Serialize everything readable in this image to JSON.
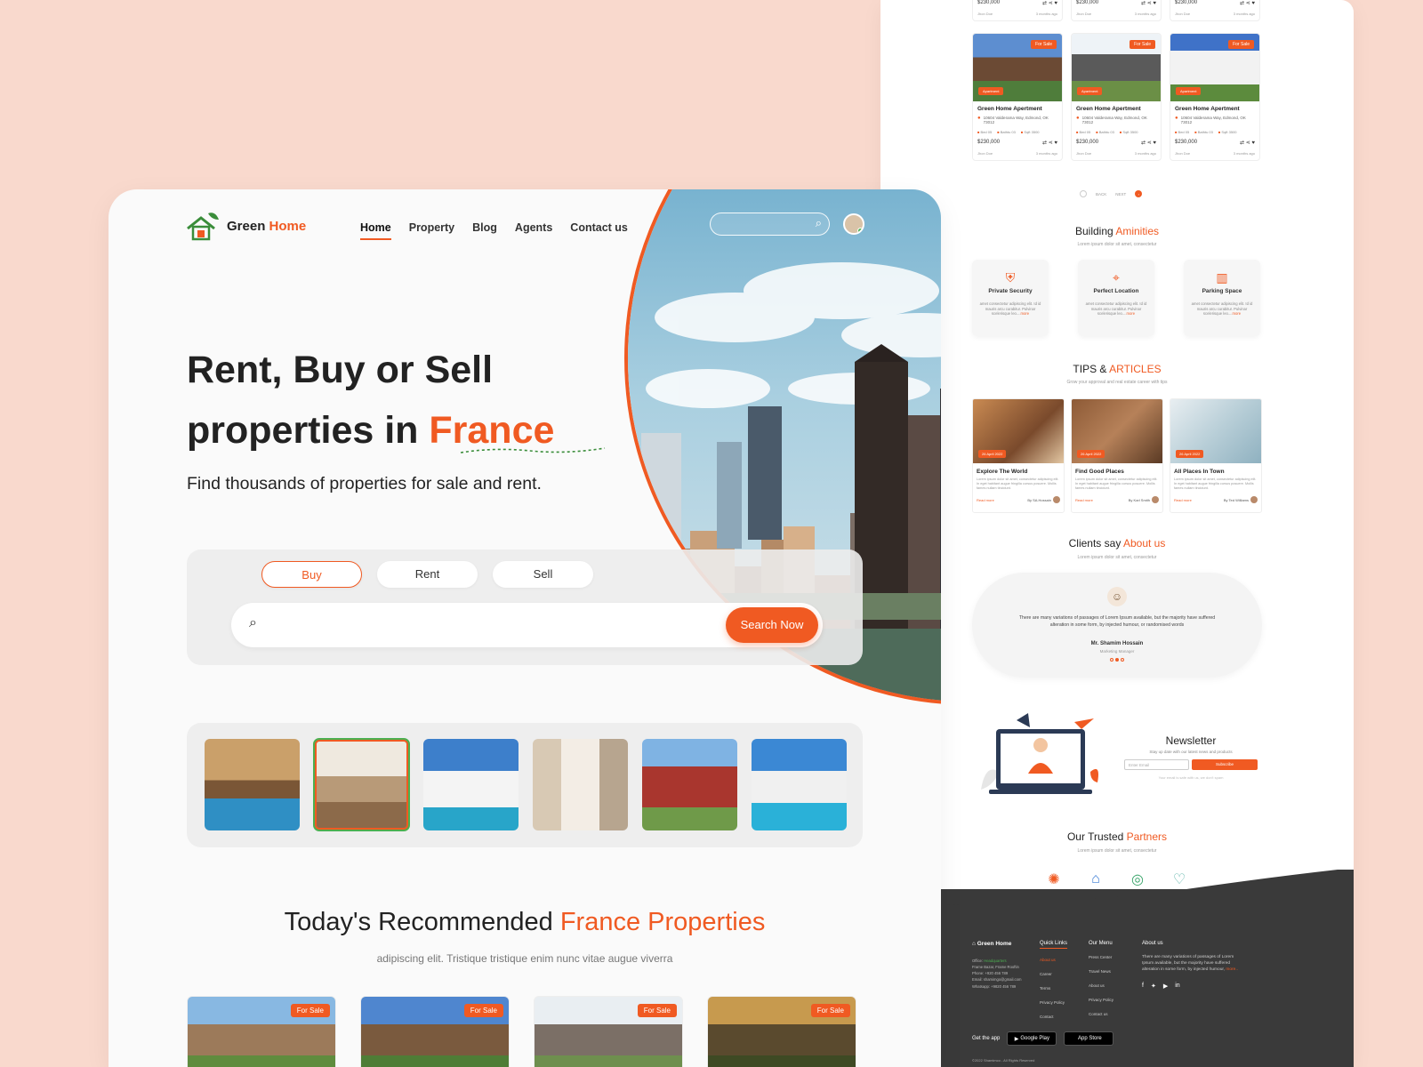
{
  "colors": {
    "accent": "#f05a22",
    "green": "#4caf50",
    "background": "#f9d9cd",
    "footer": "#3a3a3a"
  },
  "main": {
    "logo": {
      "brand_1": "Green",
      "brand_2": "Home",
      "icon": "house-logo-icon"
    },
    "nav": [
      "Home",
      "Property",
      "Blog",
      "Agents",
      "Contact us"
    ],
    "hero": {
      "line1": "Rent, Buy or Sell",
      "line2_prefix": "properties in ",
      "line2_highlight": "France",
      "subtitle": "Find thousands of properties for sale and rent."
    },
    "search": {
      "tabs": [
        "Buy",
        "Rent",
        "Sell"
      ],
      "active_tab": "Buy",
      "input_value": "",
      "button": "Search Now"
    },
    "recommended": {
      "title_prefix": "Today's Recommended ",
      "title_highlight": "France Properties",
      "subtitle": "adipiscing elit. Tristique tristique enim nunc vitae augue viverra",
      "tag": "For Sale"
    }
  },
  "right": {
    "listing": {
      "price": "$230,000",
      "title": "Green Home Apertment",
      "address": "10604 Valderama Way, Edmond, OK 73012",
      "features": [
        "Bed 05",
        "Bathtu 03",
        "Sqft 3500"
      ],
      "agent": "Jhon Doe",
      "time": "3 months ago",
      "tag_sale": "For Sale",
      "tag_type": "Apartment"
    },
    "pager": {
      "back": "BACK",
      "next": "NEXT"
    },
    "amenities": {
      "title_prefix": "Building ",
      "title_highlight": "Aminities",
      "subtitle": "Lorem ipsum dolor sit amet, consectetur",
      "items": [
        {
          "name": "Private Security",
          "icon": "shield-icon"
        },
        {
          "name": "Perfect Location",
          "icon": "location-pin-icon"
        },
        {
          "name": "Parking Space",
          "icon": "parking-icon"
        }
      ],
      "desc": "amet consectetur adipiscing elit. Id id mauris arcu curabitur. Pulvinar scelerisque leo....",
      "more": "more"
    },
    "tips": {
      "title_prefix": "TIPS & ",
      "title_highlight": "ARTICLES",
      "subtitle": "Grow your approval and real estate career with tips",
      "items": [
        {
          "title": "Explore The World",
          "date": "26 April 2022",
          "author": "By SA.Hossain"
        },
        {
          "title": "Find Good Places",
          "date": "26 April 2022",
          "author": "By Karl Smith"
        },
        {
          "title": "All Places In Town",
          "date": "26 April 2022",
          "author": "By Ted Williams"
        }
      ],
      "desc": "Lorem ipsum dolor sit amet, consectetur adipiscing elit. In eget habitant augue fringilla cursus posuere. Mollis fames nullam tincidunt.",
      "read_more": "Read more"
    },
    "testimonial": {
      "title_prefix": "Clients say ",
      "title_highlight": "About us",
      "subtitle": "Lorem ipsum dolor sit amet, consectetur",
      "text": "There are many variations of passages of Lorem Ipsum available, but the majority have suffered alteration in some form, by injected humour, or randomised words",
      "name": "Mr. Shamim Hossain",
      "role": "Marketing Manager"
    },
    "newsletter": {
      "title": "Newsletter",
      "subtitle": "Stay up date with our latest news and products",
      "placeholder": "Enter Email",
      "button": "Subscribe",
      "note": "Your email is safe with us, we don't spam"
    },
    "partners": {
      "title_prefix": "Our Trusted ",
      "title_highlight": "Partners",
      "subtitle": "Lorem ipsum dolor sit amet, consectetur"
    },
    "footer": {
      "logo": "Green Home",
      "office_label": "Office: ",
      "office_value": "Headquarters",
      "info": [
        "Frame Bazar, Frame Rooftin",
        "Phone: +920 456 789",
        "Email: shamimgo@gmail.com",
        "Whatsapp: +9820 456 789"
      ],
      "quick_links_title": "Quick Links",
      "quick_links": [
        "About us",
        "Career",
        "Terms",
        "Privacy Policy",
        "Contact"
      ],
      "menu_title": "Our Menu",
      "menu": [
        "Press Center",
        "Travel News",
        "About us",
        "Privacy Policy",
        "Contact us"
      ],
      "about_title": "About us",
      "about_text": "There are many variations of passages of Lorem Ipsum available, but the majority have suffered alteration in some form, by injected humour, ",
      "about_more": "more..",
      "get_app": "Get the app",
      "google_play": "Google Play",
      "app_store": "App Store",
      "copyright": "©2022 Shamimco - All Rights Reserved"
    }
  }
}
